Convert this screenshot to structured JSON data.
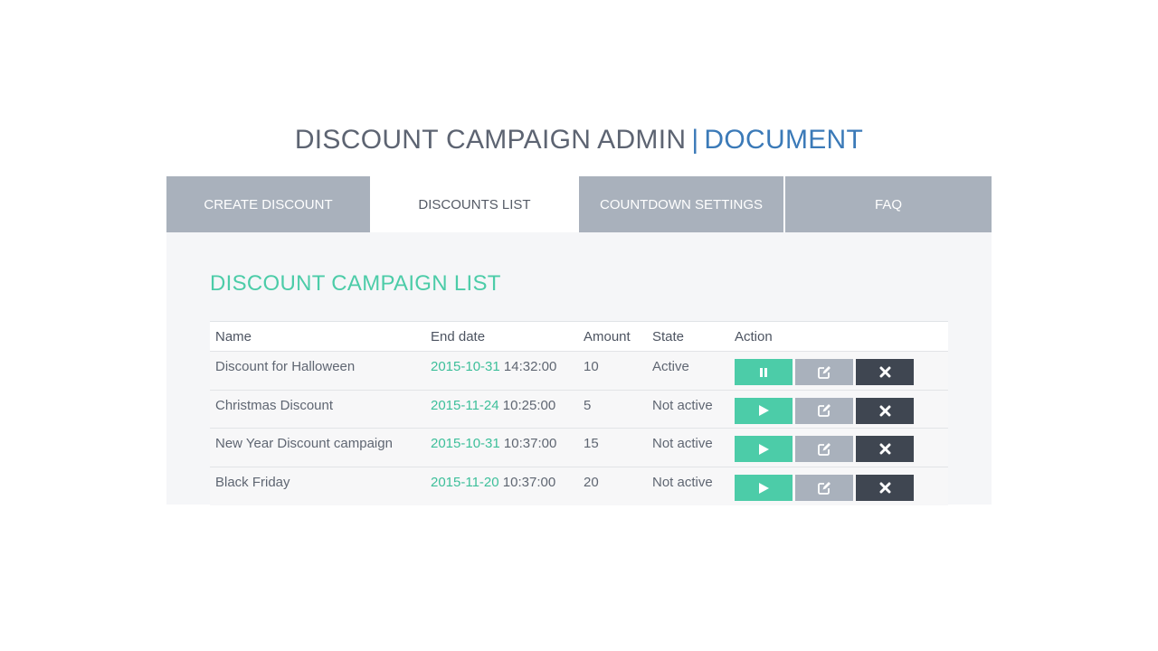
{
  "header": {
    "title_main": "DISCOUNT CAMPAIGN ADMIN",
    "separator": "|",
    "title_accent": "DOCUMENT"
  },
  "tabs": [
    {
      "label": "CREATE DISCOUNT",
      "active": false
    },
    {
      "label": "DISCOUNTS LIST",
      "active": true
    },
    {
      "label": "COUNTDOWN SETTINGS",
      "active": false
    },
    {
      "label": "FAQ",
      "active": false
    }
  ],
  "section": {
    "title": "DISCOUNT CAMPAIGN LIST"
  },
  "table": {
    "columns": [
      "Name",
      "End date",
      "Amount",
      "State",
      "Action"
    ],
    "rows": [
      {
        "name": "Discount for Halloween",
        "date": "2015-10-31",
        "time": "14:32:00",
        "amount": "10",
        "state": "Active",
        "toggle_icon": "pause-icon"
      },
      {
        "name": "Christmas Discount",
        "date": "2015-11-24",
        "time": "10:25:00",
        "amount": "5",
        "state": "Not active",
        "toggle_icon": "play-icon"
      },
      {
        "name": "New Year Discount campaign",
        "date": "2015-10-31",
        "time": "10:37:00",
        "amount": "15",
        "state": "Not active",
        "toggle_icon": "play-icon"
      },
      {
        "name": "Black Friday",
        "date": "2015-11-20",
        "time": "10:37:00",
        "amount": "20",
        "state": "Not active",
        "toggle_icon": "play-icon"
      }
    ]
  },
  "colors": {
    "accent_green": "#4ccca8",
    "accent_blue": "#3b7ab8",
    "tab_gray": "#a9b1bc",
    "dark": "#3f4651"
  }
}
